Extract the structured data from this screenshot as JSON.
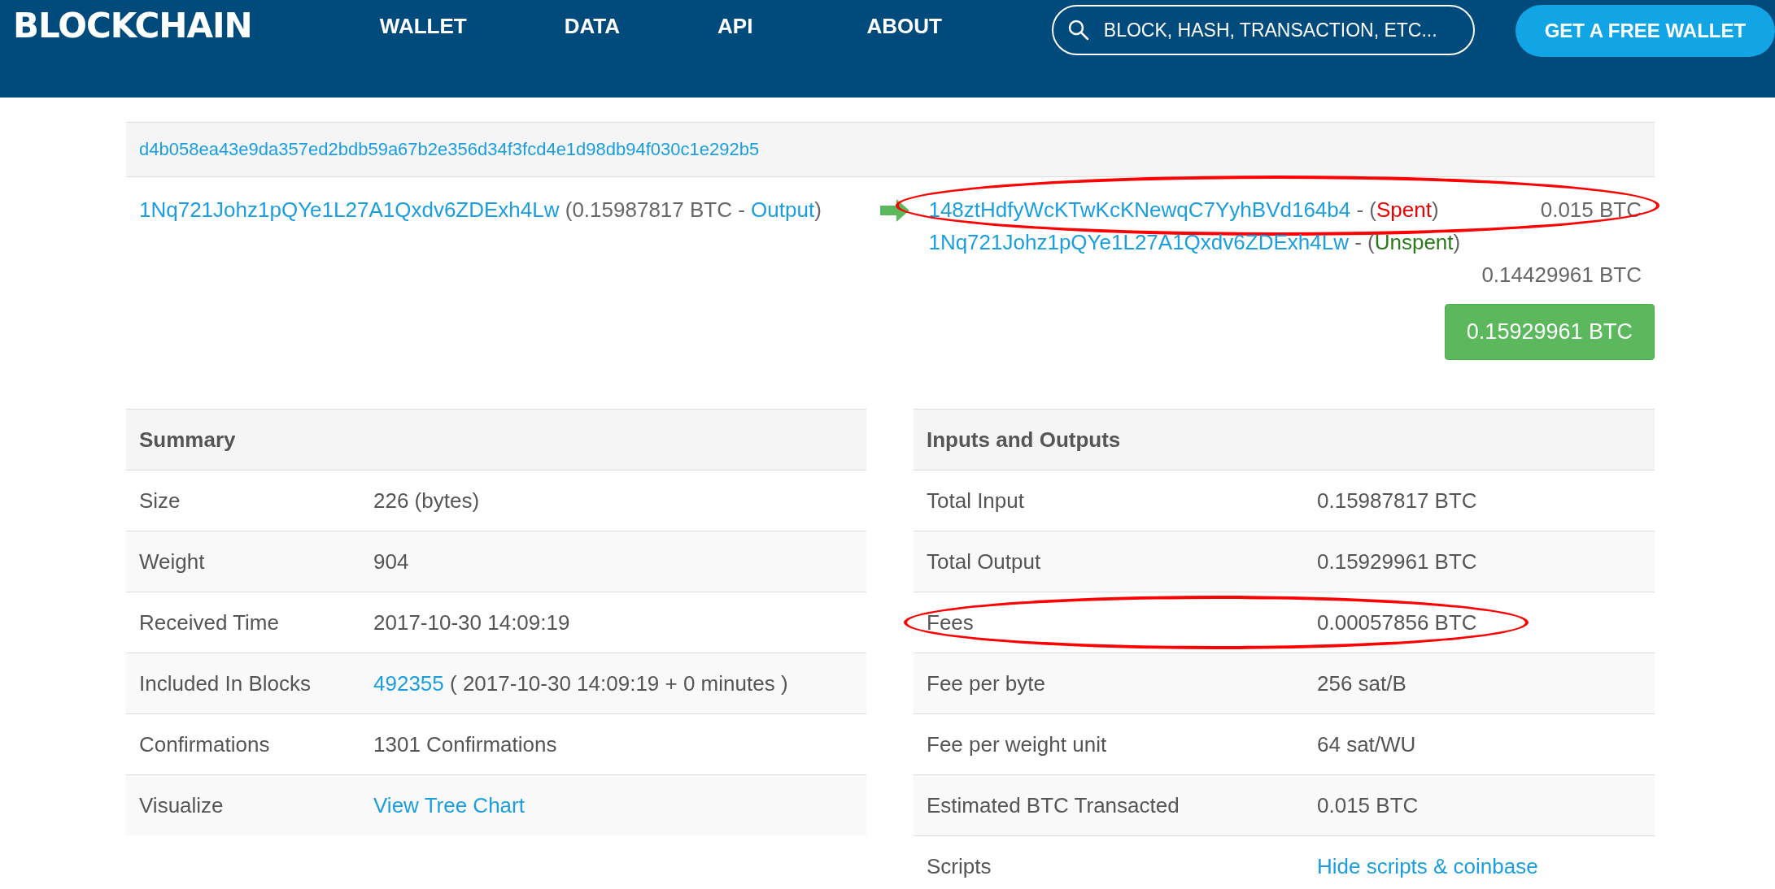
{
  "header": {
    "logo": "BLOCKCHAIN",
    "nav": [
      {
        "label": "WALLET"
      },
      {
        "label": "DATA"
      },
      {
        "label": "API"
      },
      {
        "label": "ABOUT"
      }
    ],
    "search": {
      "placeholder": "BLOCK, HASH, TRANSACTION, ETC..."
    },
    "cta": "GET A FREE WALLET"
  },
  "transaction": {
    "hash": "d4b058ea43e9da357ed2bdb59a67b2e356d34f3fcd4e1d98db94f030c1e292b5",
    "inputs": [
      {
        "address": "1Nq721Johz1pQYe1L27A1Qxdv6ZDExh4Lw",
        "amount_text": "(0.15987817 BTC -",
        "output_link": "Output",
        "close": ")"
      }
    ],
    "outputs": [
      {
        "address": "148ztHdfyWcKTwKcKNewqC7YyhBVd164b4",
        "prefix": "- (",
        "status": "Spent",
        "suffix": ")",
        "spent": true,
        "amount": "0.015 BTC",
        "highlighted": true
      },
      {
        "address": "1Nq721Johz1pQYe1L27A1Qxdv6ZDExh4Lw",
        "prefix": "- (",
        "status": "Unspent",
        "suffix": ")",
        "spent": false,
        "amount": "0.14429961 BTC",
        "highlighted": false
      }
    ],
    "total": "0.15929961 BTC"
  },
  "tables": [
    {
      "title": "Summary",
      "rows": [
        {
          "label": "Size",
          "value": "226 (bytes)",
          "highlighted": false
        },
        {
          "label": "Weight",
          "value": "904",
          "highlighted": false
        },
        {
          "label": "Received Time",
          "value": "2017-10-30 14:09:19",
          "highlighted": false
        },
        {
          "label": "Included In Blocks",
          "link": "492355",
          "value": "( 2017-10-30 14:09:19 + 0 minutes )",
          "highlighted": false
        },
        {
          "label": "Confirmations",
          "value": "1301 Confirmations",
          "highlighted": false
        },
        {
          "label": "Visualize",
          "link": "View Tree Chart",
          "highlighted": false
        }
      ]
    },
    {
      "title": "Inputs and Outputs",
      "rows": [
        {
          "label": "Total Input",
          "value": "0.15987817 BTC",
          "highlighted": false
        },
        {
          "label": "Total Output",
          "value": "0.15929961 BTC",
          "highlighted": false
        },
        {
          "label": "Fees",
          "value": "0.00057856 BTC",
          "highlighted": true
        },
        {
          "label": "Fee per byte",
          "value": "256 sat/B",
          "highlighted": false
        },
        {
          "label": "Fee per weight unit",
          "value": "64 sat/WU",
          "highlighted": false
        },
        {
          "label": "Estimated BTC Transacted",
          "value": "0.015 BTC",
          "highlighted": false
        },
        {
          "label": "Scripts",
          "link": "Hide scripts & coinbase",
          "highlighted": false
        }
      ]
    }
  ]
}
